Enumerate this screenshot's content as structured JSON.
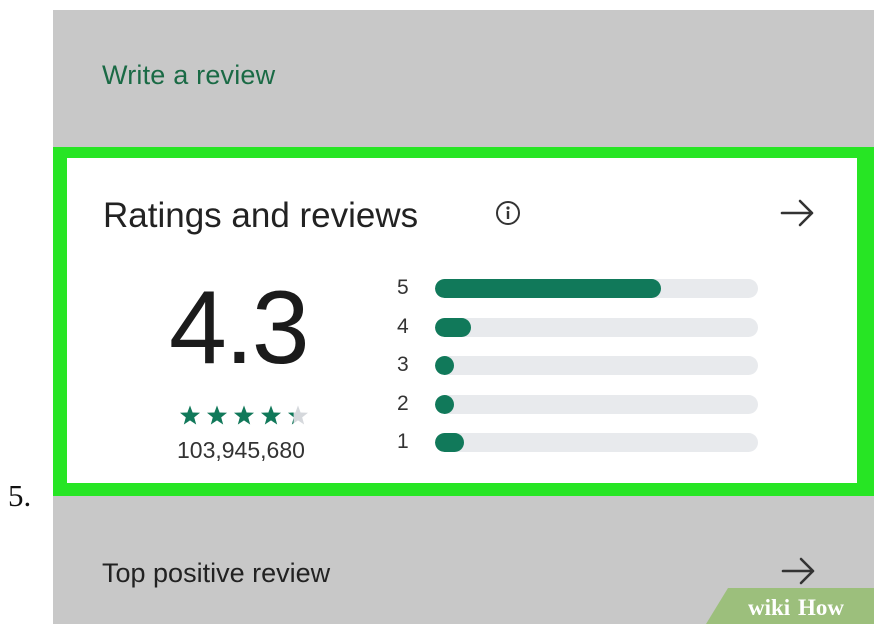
{
  "step": {
    "number": "5."
  },
  "write_review": {
    "label": "Write a review"
  },
  "ratings_card": {
    "title": "Ratings and reviews",
    "average": "4.3",
    "star_rating": 4.3,
    "review_count": "103,945,680",
    "distribution": [
      {
        "label": "5",
        "fraction": 0.7
      },
      {
        "label": "4",
        "fraction": 0.11
      },
      {
        "label": "3",
        "fraction": 0.06
      },
      {
        "label": "2",
        "fraction": 0.06
      },
      {
        "label": "1",
        "fraction": 0.09
      }
    ]
  },
  "top_positive": {
    "label": "Top positive review"
  },
  "watermark": {
    "text_wiki": "wiki",
    "text_how": "How"
  },
  "colors": {
    "accent_green": "#11795a",
    "highlight_green": "#27e524",
    "link_green": "#1a6a45",
    "bar_track": "#e8eaed",
    "screen_gray": "#c8c8c8"
  },
  "icons": {
    "info": "info-icon",
    "arrow": "arrow-right-icon",
    "star": "star-icon"
  }
}
